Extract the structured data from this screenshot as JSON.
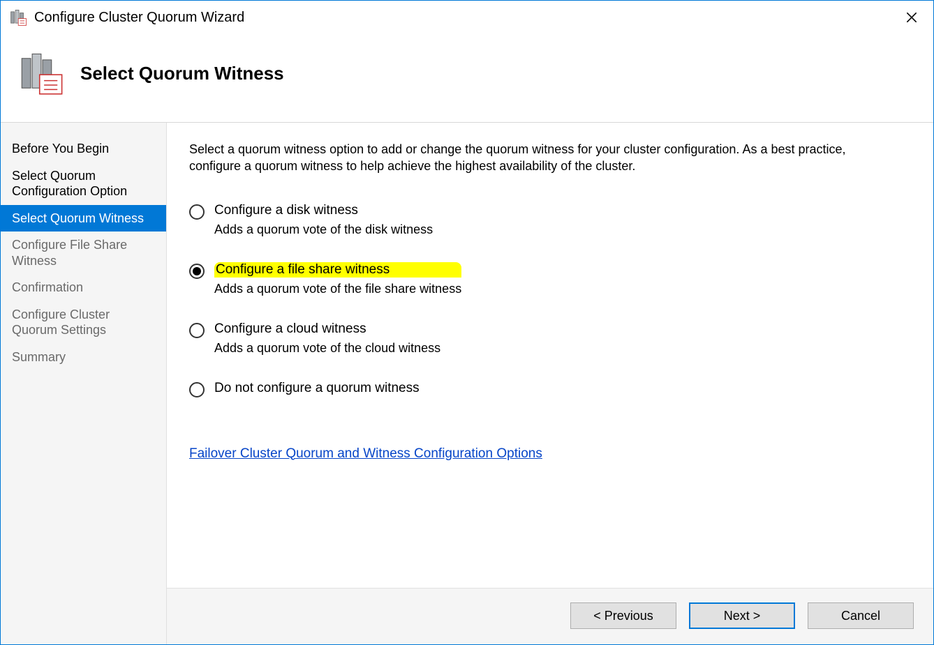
{
  "window": {
    "title": "Configure Cluster Quorum Wizard"
  },
  "header": {
    "title": "Select Quorum Witness"
  },
  "sidebar": {
    "items": [
      {
        "label": "Before You Begin",
        "state": "completed"
      },
      {
        "label": "Select Quorum Configuration Option",
        "state": "completed"
      },
      {
        "label": "Select Quorum Witness",
        "state": "selected"
      },
      {
        "label": "Configure File Share Witness",
        "state": "pending"
      },
      {
        "label": "Confirmation",
        "state": "pending"
      },
      {
        "label": "Configure Cluster Quorum Settings",
        "state": "pending"
      },
      {
        "label": "Summary",
        "state": "pending"
      }
    ]
  },
  "content": {
    "instruction": "Select a quorum witness option to add or change the quorum witness for your cluster configuration. As a best practice, configure a quorum witness to help achieve the highest availability of the cluster.",
    "options": [
      {
        "label": "Configure a disk witness",
        "description": "Adds a quorum vote of the disk witness",
        "selected": false,
        "highlighted": false
      },
      {
        "label": "Configure a file share witness",
        "description": "Adds a quorum vote of the file share witness",
        "selected": true,
        "highlighted": true
      },
      {
        "label": "Configure a cloud witness",
        "description": "Adds a quorum vote of the cloud witness",
        "selected": false,
        "highlighted": false
      },
      {
        "label": "Do not configure a quorum witness",
        "description": "",
        "selected": false,
        "highlighted": false
      }
    ],
    "help_link": "Failover Cluster Quorum and Witness Configuration Options"
  },
  "footer": {
    "previous": "< Previous",
    "next": "Next >",
    "cancel": "Cancel"
  }
}
